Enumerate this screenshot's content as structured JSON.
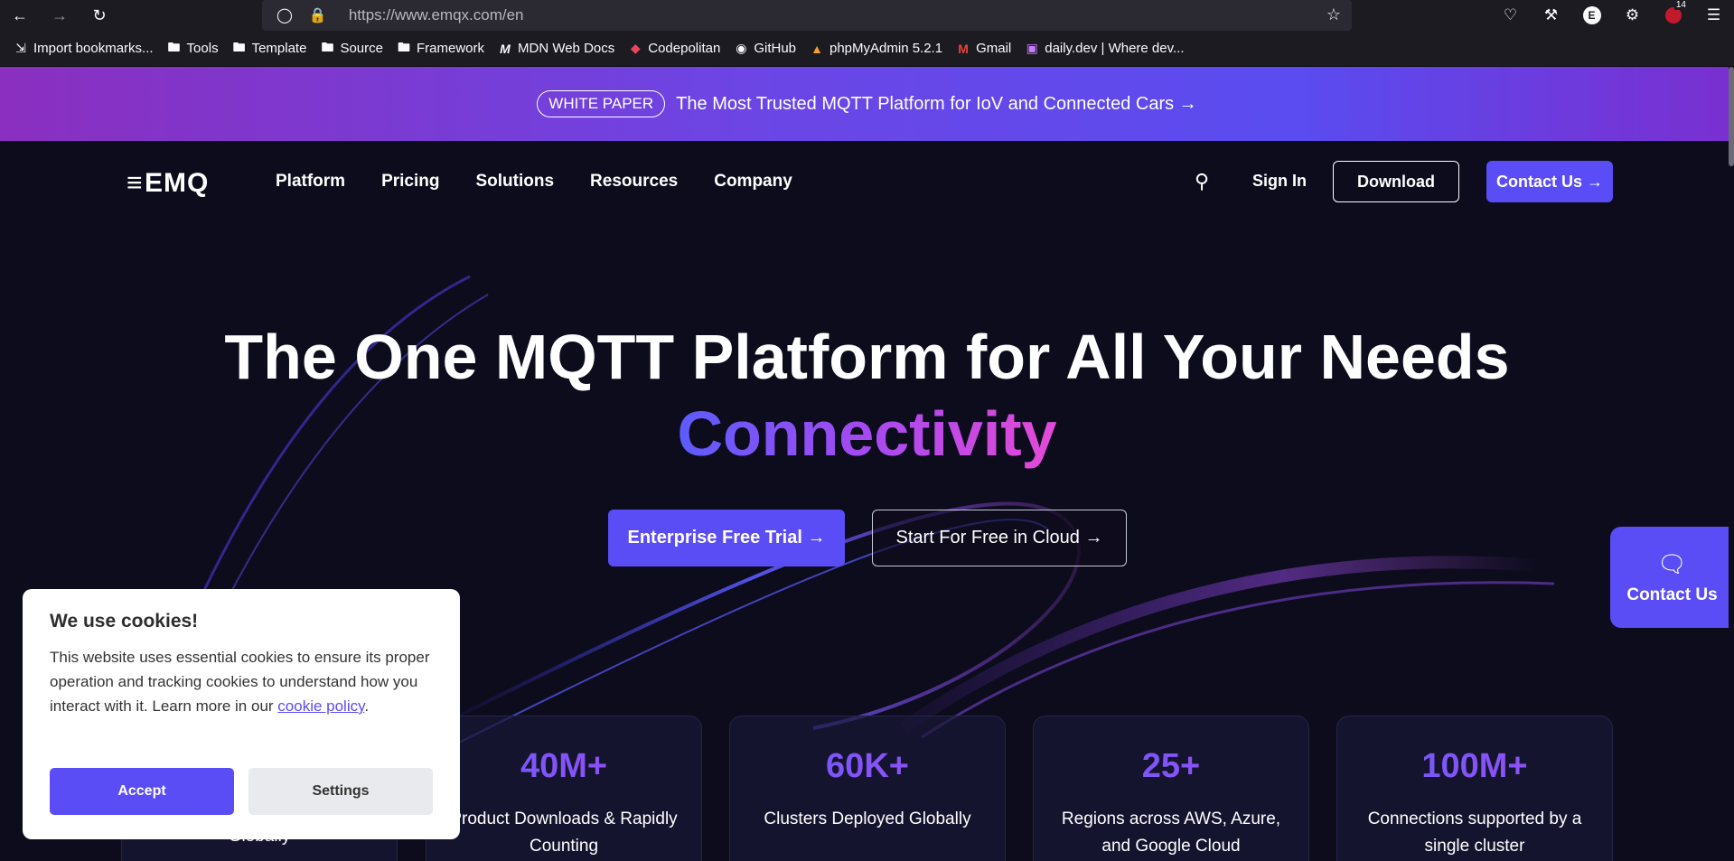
{
  "browser": {
    "url": "https://www.emqx.com/en",
    "profile_initial": "E",
    "extension_badge": "14",
    "bookmarks": [
      {
        "label": "Import bookmarks...",
        "icon": "import-icon"
      },
      {
        "label": "Tools",
        "icon": "folder-icon"
      },
      {
        "label": "Template",
        "icon": "folder-icon"
      },
      {
        "label": "Source",
        "icon": "folder-icon"
      },
      {
        "label": "Framework",
        "icon": "folder-icon"
      },
      {
        "label": "MDN Web Docs",
        "icon": "mdn-icon"
      },
      {
        "label": "Codepolitan",
        "icon": "codepolitan-icon"
      },
      {
        "label": "GitHub",
        "icon": "github-icon"
      },
      {
        "label": "phpMyAdmin 5.2.1",
        "icon": "phpmyadmin-icon"
      },
      {
        "label": "Gmail",
        "icon": "gmail-icon"
      },
      {
        "label": "daily.dev | Where dev...",
        "icon": "dailydev-icon"
      }
    ]
  },
  "promo": {
    "badge": "WHITE PAPER",
    "text": "The Most Trusted MQTT Platform for IoV and Connected Cars →"
  },
  "header": {
    "logo": "EMQ",
    "nav": [
      "Platform",
      "Pricing",
      "Solutions",
      "Resources",
      "Company"
    ],
    "sign_in": "Sign In",
    "download": "Download",
    "contact": "Contact Us →"
  },
  "hero": {
    "title": "The One MQTT Platform for All Your Needs",
    "subtitle": "Connectivity",
    "primary_cta": "Enterprise Free Trial →",
    "secondary_cta": "Start For Free in Cloud →"
  },
  "stats": [
    {
      "value": "",
      "label": "Globally"
    },
    {
      "value": "40M+",
      "label": "Product Downloads & Rapidly Counting"
    },
    {
      "value": "60K+",
      "label": "Clusters Deployed Globally"
    },
    {
      "value": "25+",
      "label": "Regions across AWS, Azure, and Google Cloud"
    },
    {
      "value": "100M+",
      "label": "Connections supported by a single cluster"
    }
  ],
  "float_contact": {
    "label": "Contact Us"
  },
  "cookie": {
    "title": "We use cookies!",
    "body": "This website uses essential cookies to ensure its proper operation and tracking cookies to understand how you interact with it. Learn more in our ",
    "link": "cookie policy",
    "after_link": ".",
    "accept": "Accept",
    "settings": "Settings"
  },
  "colors": {
    "accent": "#5b4df6",
    "background": "#0d0c1d",
    "promo_start": "#8a2fbf",
    "promo_end": "#5a4cf0"
  }
}
